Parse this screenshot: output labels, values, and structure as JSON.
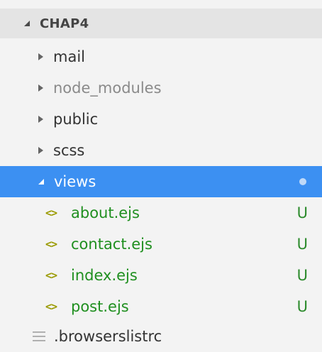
{
  "section": {
    "title": "CHAP4"
  },
  "folders": [
    {
      "label": "mail",
      "state": "collapsed"
    },
    {
      "label": "node_modules",
      "state": "collapsed",
      "muted": true
    },
    {
      "label": "public",
      "state": "collapsed"
    },
    {
      "label": "scss",
      "state": "collapsed"
    },
    {
      "label": "views",
      "state": "expanded",
      "selected": true
    }
  ],
  "files": [
    {
      "label": "about.ejs",
      "badge": "U",
      "icon": "code-file-icon"
    },
    {
      "label": "contact.ejs",
      "badge": "U",
      "icon": "code-file-icon"
    },
    {
      "label": "index.ejs",
      "badge": "U",
      "icon": "code-file-icon"
    },
    {
      "label": "post.ejs",
      "badge": "U",
      "icon": "code-file-icon"
    }
  ],
  "dotfile": {
    "label": ".browserslistrc",
    "icon": "lines-file-icon"
  },
  "icons": {
    "code": "<>"
  },
  "colors": {
    "selection": "#3c90f2",
    "untracked": "#2b8a2b",
    "header_bg": "#e4e4e4",
    "background": "#f3f3f3"
  }
}
